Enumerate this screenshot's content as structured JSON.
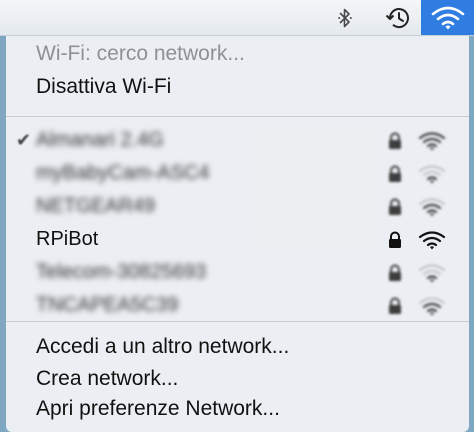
{
  "menubar": {
    "icons": [
      "bluetooth-icon",
      "time-machine-icon",
      "wifi-icon"
    ],
    "accent": "#2f7de1"
  },
  "menu": {
    "status": "Wi-Fi: cerco network...",
    "toggle": "Disattiva Wi-Fi",
    "networks": [
      {
        "name": "Almanari 2.4G",
        "connected": true,
        "secured": true,
        "strength": 3
      },
      {
        "name": "myBabyCam-ASC4",
        "connected": false,
        "secured": true,
        "strength": 1
      },
      {
        "name": "NETGEAR49",
        "connected": false,
        "secured": true,
        "strength": 2
      },
      {
        "name": "RPiBot",
        "connected": false,
        "secured": true,
        "strength": 3
      },
      {
        "name": "Telecom-30825693",
        "connected": false,
        "secured": true,
        "strength": 1
      },
      {
        "name": "TNCAPEA5C39",
        "connected": false,
        "secured": true,
        "strength": 2
      }
    ],
    "actions": {
      "join_other": "Accedi a un altro network...",
      "create": "Crea network...",
      "preferences": "Apri preferenze Network..."
    }
  }
}
